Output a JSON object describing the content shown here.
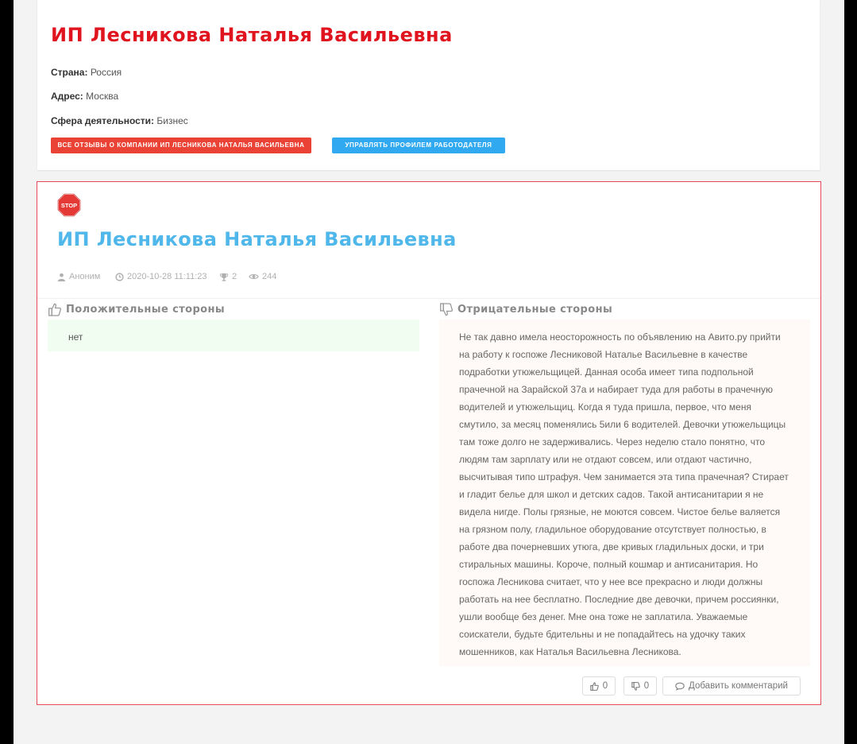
{
  "company": {
    "title": "ИП Лесникова Наталья Васильевна",
    "country_label": "Страна:",
    "country_value": "Россия",
    "address_label": "Адрес:",
    "address_value": "Москва",
    "sphere_label": "Сфера деятельности:",
    "sphere_value": "Бизнес",
    "all_reviews_button": "Все отзывы о компании ИП Лесникова Наталья Васильевна",
    "manage_profile_button": "Управлять профилем работодателя"
  },
  "review": {
    "badge_text": "STOP",
    "title": "ИП Лесникова Наталья Васильевна",
    "author": "Аноним",
    "datetime": "2020-10-28 11:11:23",
    "trophy_count": "2",
    "views": "244",
    "positive_heading": "Положительные стороны",
    "positive_text": "нет",
    "negative_heading": "Отрицательные стороны",
    "negative_text": "Не так давно имела неосторожность по объявлению на Авито.ру прийти на работу к госпоже Лесниковой Наталье Васильевне в качестве подработки утюжельщицей. Данная особа имеет типа подпольной прачечной на Зарайской 37а и набирает туда для работы в прачечную водителей и утюжельщиц. Когда я туда пришла, первое, что меня смутило, за месяц поменялись 5или 6 водителей. Девочки утюжельщицы там тоже долго не задерживались. Через неделю стало понятно, что людям там зарплату или не отдают совсем, или отдают частично, высчитывая типо штрафуя. Чем занимается эта типа прачечная? Стирает и гладит белье для школ и детских садов. Такой антисанитарии я не видела нигде. Полы грязные, не моются совсем. Чистое белье валяется на грязном полу, гладильное оборудование отсутствует полностью, в работе два почерневших утюга, две кривых гладильных доски, и три стиральных машины. Короче, полный кошмар и антисанитария. Но госпожа Лесникова считает, что у нее все прекрасно и люди должны работать на нее бесплатно. Последние две девочки, причем россиянки, ушли вообще без денег. Мне она тоже не заплатила. Уважаемые соискатели, будьте бдительны и не попадайтесь на удочку таких мошенников, как Наталья Васильевна Лесникова.",
    "likes": "0",
    "dislikes": "0",
    "add_comment": "Добавить комментарий"
  },
  "colors": {
    "company_title": "#e0141e",
    "review_title": "#4fb7ea",
    "red_button": "#ea4335",
    "blue_button": "#31a9f0",
    "card_border": "#e94a5a"
  }
}
